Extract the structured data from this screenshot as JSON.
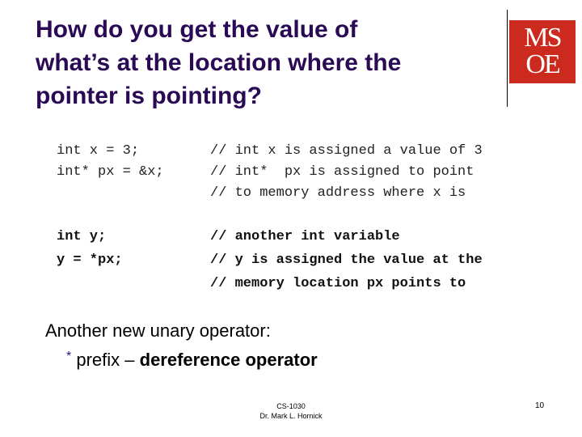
{
  "slide": {
    "title_lines": [
      "How do you get the value of",
      "what’s at the location where the",
      "pointer is pointing?"
    ],
    "logo": {
      "line1": "MS",
      "line2": "OE",
      "color": "#cc2a1e"
    },
    "code_block_1": {
      "code": [
        "int x = 3;",
        "int* px = &x;",
        ""
      ],
      "comments": [
        "// int x is assigned a value of 3",
        "// int*  px is assigned to point",
        "// to memory address where x is"
      ]
    },
    "code_block_2": {
      "code": [
        "int y;",
        "y = *px;",
        ""
      ],
      "comments": [
        "// another int variable",
        "// y is assigned the value at the",
        "// memory location px points to"
      ]
    },
    "note": "Another new unary operator:",
    "sub_bullet": {
      "symbol": "*",
      "text": "prefix – ",
      "bold_text": "dereference operator"
    },
    "footer": {
      "course": "CS-1030",
      "author": "Dr. Mark L. Hornick"
    },
    "page_number": "10"
  }
}
